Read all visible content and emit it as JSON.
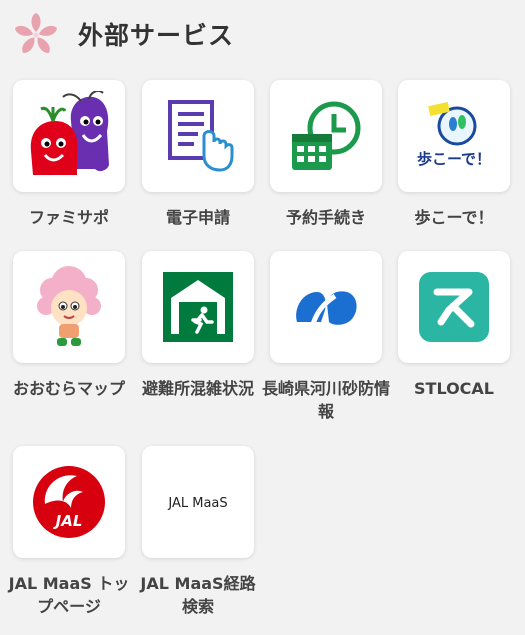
{
  "header": {
    "title": "外部サービス",
    "logo_icon": "cherry-blossom-icon"
  },
  "services": [
    {
      "label": "ファミサポ",
      "icon": "famisapo-mascot-icon"
    },
    {
      "label": "電子申請",
      "icon": "e-application-document-icon"
    },
    {
      "label": "予約手続き",
      "icon": "reservation-calendar-clock-icon"
    },
    {
      "label": "歩こーで！",
      "icon": "arukode-walking-app-icon"
    },
    {
      "label": "おおむらマップ",
      "icon": "omura-map-mascot-icon"
    },
    {
      "label": "避難所混雑状況",
      "icon": "evacuation-shelter-icon"
    },
    {
      "label": "長崎県河川砂防情報",
      "icon": "nagasaki-river-info-icon"
    },
    {
      "label": "STLOCAL",
      "icon": "stlocal-app-icon"
    },
    {
      "label": "JAL MaaS トップページ",
      "icon": "jal-crane-logo-icon"
    },
    {
      "label": "JAL MaaS経路検索",
      "icon": "jal-maas-logo-icon"
    }
  ],
  "jal_logo_text": "JAL",
  "jal_maas_logo_text": "JAL MaaS",
  "arukode_icon_text": "歩こーで！",
  "colors": {
    "background": "#f2f2f2",
    "tile": "#ffffff",
    "text": "#444444",
    "jal_red": "#d7000f",
    "stlocal": "#2bb5a3",
    "evac_green": "#007a3d"
  }
}
